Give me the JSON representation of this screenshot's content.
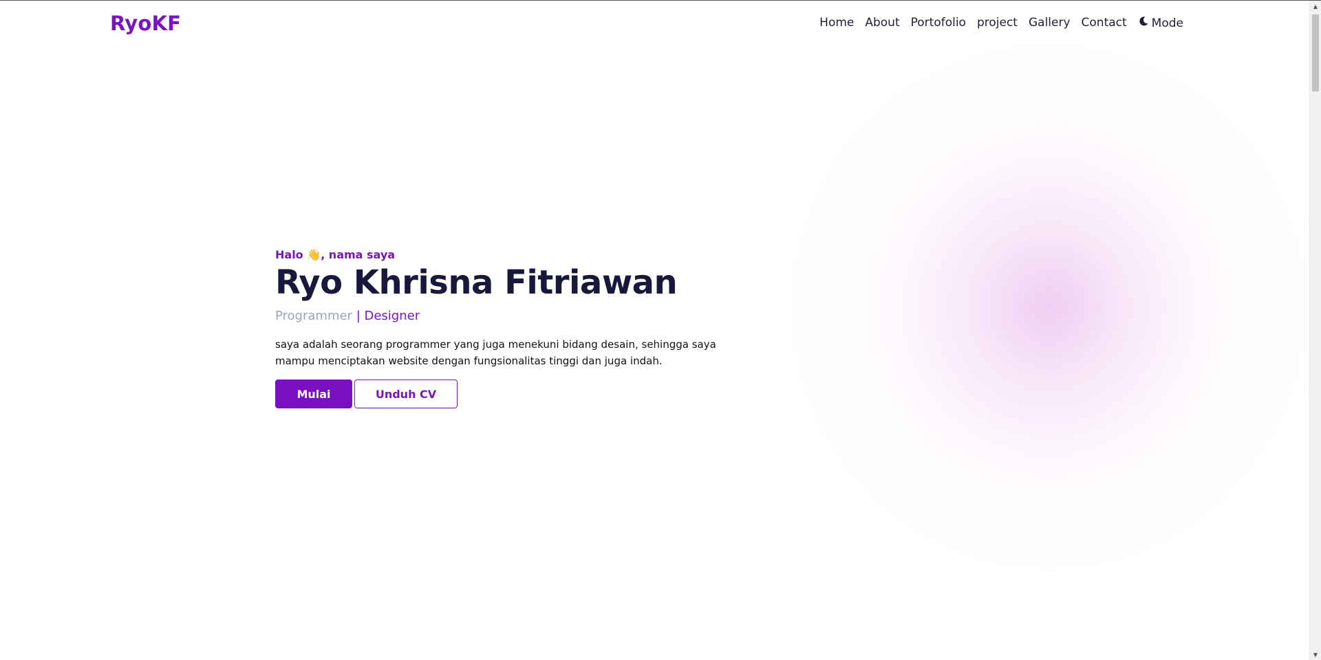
{
  "navbar": {
    "brand": "RyoKF",
    "links": [
      "Home",
      "About",
      "Portofolio",
      "project",
      "Gallery",
      "Contact"
    ],
    "mode_label": "Mode"
  },
  "hero": {
    "greeting_pre": "Halo ",
    "greeting_emoji": "👋",
    "greeting_post": ", nama saya",
    "name": "Ryo Khrisna Fitriawan",
    "role_1": "Programmer",
    "role_separator": " | ",
    "role_2": "Designer",
    "description": "saya adalah seorang programmer yang juga menekuni bidang desain, sehingga saya mampu menciptakan website dengan fungsionalitas tinggi dan juga indah.",
    "primary_button": "Mulai",
    "secondary_button": "Unduh CV"
  },
  "colors": {
    "accent": "#7a14c1",
    "heading": "#17183b",
    "muted_role": "#9aa6b8",
    "glow": "#e2a6e8"
  },
  "icons": {
    "mode_toggle": "moon-icon"
  }
}
